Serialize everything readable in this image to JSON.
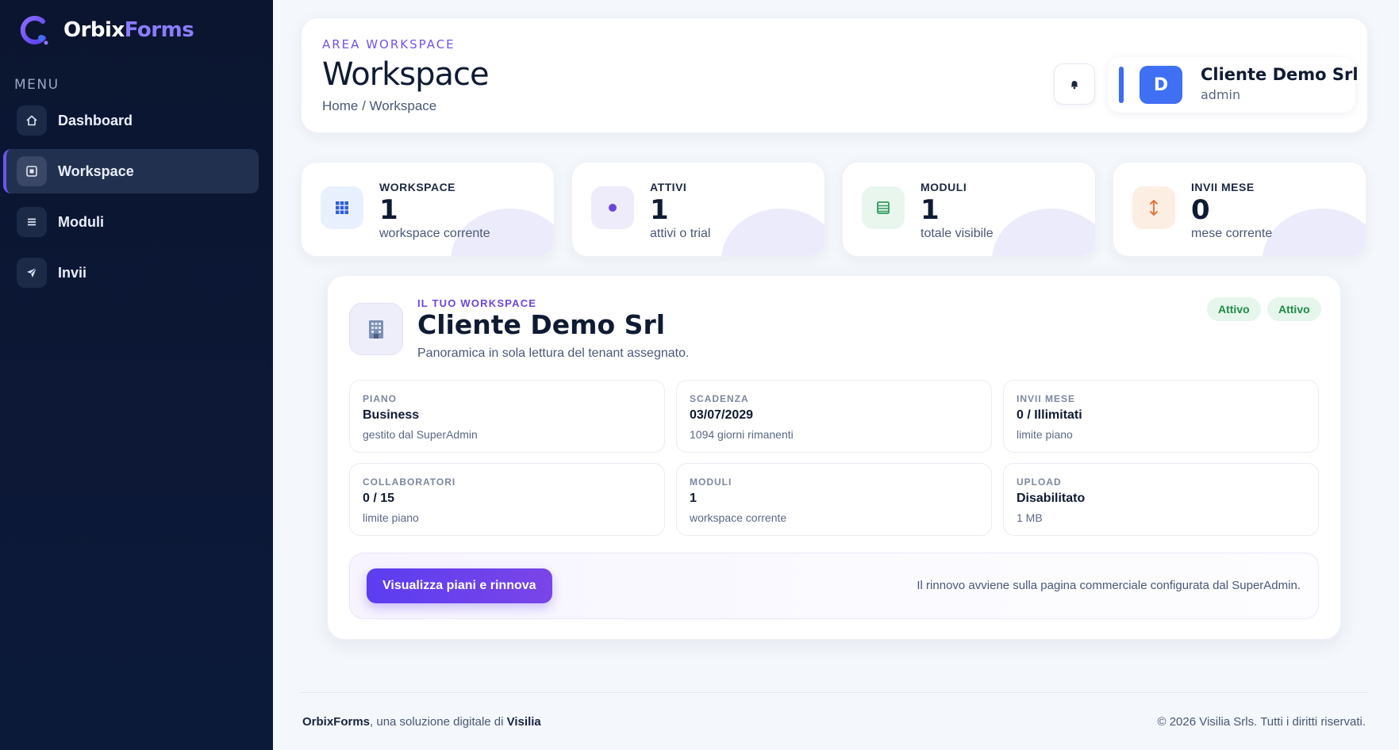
{
  "brand": {
    "name_a": "Orbix",
    "name_b": "Forms"
  },
  "sidebar": {
    "menu_title": "MENU",
    "items": [
      {
        "label": "Dashboard",
        "icon": "home-icon"
      },
      {
        "label": "Workspace",
        "icon": "workspace-icon"
      },
      {
        "label": "Moduli",
        "icon": "list-icon"
      },
      {
        "label": "Invii",
        "icon": "send-icon"
      }
    ]
  },
  "header": {
    "area_label": "AREA WORKSPACE",
    "title": "Workspace",
    "breadcrumb": "Home / Workspace",
    "notification_icon": "bell-icon",
    "user": {
      "avatar_letter": "D",
      "name": "Cliente Demo Srl",
      "role": "admin"
    }
  },
  "stats": [
    {
      "label": "WORKSPACE",
      "value": "1",
      "sub": "workspace corrente",
      "icon": "grid-icon",
      "icon_bg": "#e9f0fd",
      "icon_color": "#2f5fd6"
    },
    {
      "label": "ATTIVI",
      "value": "1",
      "sub": "attivi o trial",
      "icon": "dot-icon",
      "icon_bg": "#eeebfb",
      "icon_color": "#6b46dd"
    },
    {
      "label": "MODULI",
      "value": "1",
      "sub": "totale visibile",
      "icon": "table-icon",
      "icon_bg": "#e8f6ee",
      "icon_color": "#2f9a5a"
    },
    {
      "label": "INVII MESE",
      "value": "0",
      "sub": "mese corrente",
      "icon": "arrows-icon",
      "icon_bg": "#fdeee4",
      "icon_color": "#e86a2a"
    }
  ],
  "workspace": {
    "kicker": "IL TUO WORKSPACE",
    "name": "Cliente Demo Srl",
    "description": "Panoramica in sola lettura del tenant assegnato.",
    "badges": [
      "Attivo",
      "Attivo"
    ],
    "info": [
      {
        "label": "PIANO",
        "value": "Business",
        "sub": "gestito dal SuperAdmin"
      },
      {
        "label": "SCADENZA",
        "value": "03/07/2029",
        "sub": "1094 giorni rimanenti"
      },
      {
        "label": "INVII MESE",
        "value": "0 / Illimitati",
        "sub": "limite piano"
      },
      {
        "label": "COLLABORATORI",
        "value": "0 / 15",
        "sub": "limite piano"
      },
      {
        "label": "MODULI",
        "value": "1",
        "sub": "workspace corrente"
      },
      {
        "label": "UPLOAD",
        "value": "Disabilitato",
        "sub": "1 MB"
      }
    ],
    "renew_button": "Visualizza piani e rinnova",
    "renew_note": "Il rinnovo avviene sulla pagina commerciale configurata dal SuperAdmin."
  },
  "footer": {
    "brand": "OrbixForms",
    "middle": ", una soluzione digitale di ",
    "company": "Visilia",
    "copyright": "© 2026 Visilia Srls. Tutti i diritti riservati."
  },
  "colors": {
    "accent": "#6c55f2",
    "sidebar_bg": "#0b1530",
    "success": "#1f8a4a"
  }
}
